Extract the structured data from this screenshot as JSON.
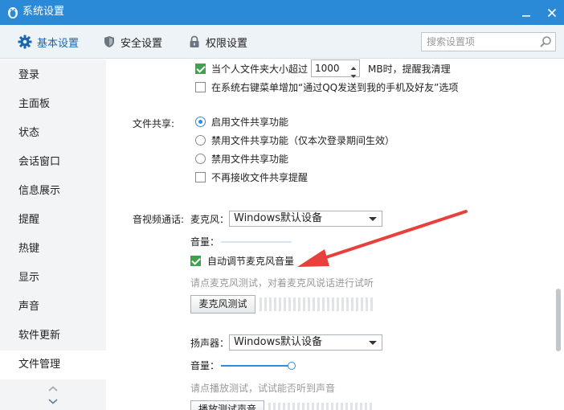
{
  "window": {
    "title": "系统设置"
  },
  "nav": {
    "tabs": [
      {
        "label": "基本设置"
      },
      {
        "label": "安全设置"
      },
      {
        "label": "权限设置"
      }
    ],
    "search_placeholder": "搜索设置项"
  },
  "sidebar": {
    "items": [
      "登录",
      "主面板",
      "状态",
      "会话窗口",
      "信息展示",
      "提醒",
      "热键",
      "显示",
      "声音",
      "软件更新",
      "文件管理"
    ],
    "active": "文件管理"
  },
  "content": {
    "folder_limit": {
      "prefix": "当个人文件夹大小超过",
      "value": "1000",
      "suffix": "MB时，提醒我清理",
      "checked": true
    },
    "context_menu_option": {
      "label": "在系统右键菜单增加“通过QQ发送到我的手机及好友”选项",
      "checked": false
    },
    "file_share": {
      "label": "文件共享:",
      "options": [
        "启用文件共享功能",
        "禁用文件共享功能（仅本次登录期间生效）",
        "禁用文件共享功能"
      ],
      "selected_index": 0,
      "no_remind": {
        "label": "不再接收文件共享提醒",
        "checked": false
      }
    },
    "av": {
      "label": "音视频通话:",
      "mic": {
        "label": "麦克风：",
        "device": "Windows默认设备",
        "volume_label": "音量：",
        "volume_level": 0,
        "auto_adjust": {
          "label": "自动调节麦克风音量",
          "checked": true
        },
        "hint": "请点麦克风测试，对着麦克风说话进行试听",
        "test_button": "麦克风测试"
      },
      "speaker": {
        "label": "扬声器：",
        "device": "Windows默认设备",
        "volume_label": "音量：",
        "volume_level": 1.0,
        "hint": "请点播放测试，试试能否听到声音",
        "test_button": "播放测试声音"
      }
    }
  },
  "colors": {
    "titlebar": "#2b8ad8",
    "accent": "#1a66b3",
    "check_green": "#3fa34d",
    "annotation_arrow": "#e8403a"
  }
}
